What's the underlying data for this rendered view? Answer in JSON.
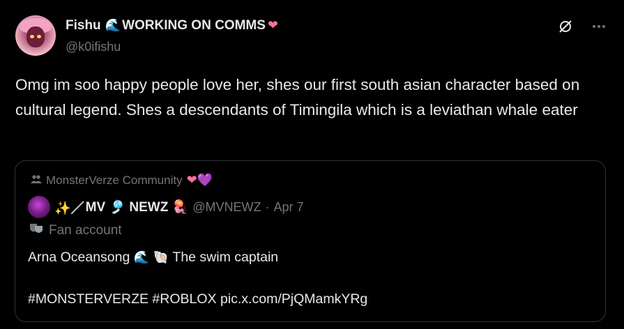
{
  "author": {
    "display_name": "Fishu",
    "name_suffix": "WORKING ON COMMS",
    "name_emoji_1": "🌊",
    "name_emoji_2": "❤",
    "handle": "@k0ifishu"
  },
  "icons": {
    "grok": "grok-slash-icon",
    "more": "more-options-icon"
  },
  "tweet": {
    "text": "Omg im soo happy people love her, shes our first south asian character based on cultural legend. Shes a descendants of Timingila which is a leviathan whale eater"
  },
  "quote": {
    "community_label": "MonsterVerze Community",
    "community_hearts": [
      "❤",
      "💜"
    ],
    "author_prefix": "✨／",
    "author_name": "MV 🎐 NEWZ 🪼",
    "author_handle": "@MVNEWZ",
    "separator": "·",
    "date": "Apr 7",
    "fan_label": "Fan account",
    "text_line1_a": "Arna Oceansong",
    "text_line1_emoji": "🌊 🐚",
    "text_line1_b": "The swim captain",
    "text_line2": "#MONSTERVERZE #ROBLOX pic.x.com/PjQMamkYRg"
  },
  "colors": {
    "background": "#000000",
    "text": "#e7e9ea",
    "muted": "#71767b",
    "border": "#2f3336"
  }
}
